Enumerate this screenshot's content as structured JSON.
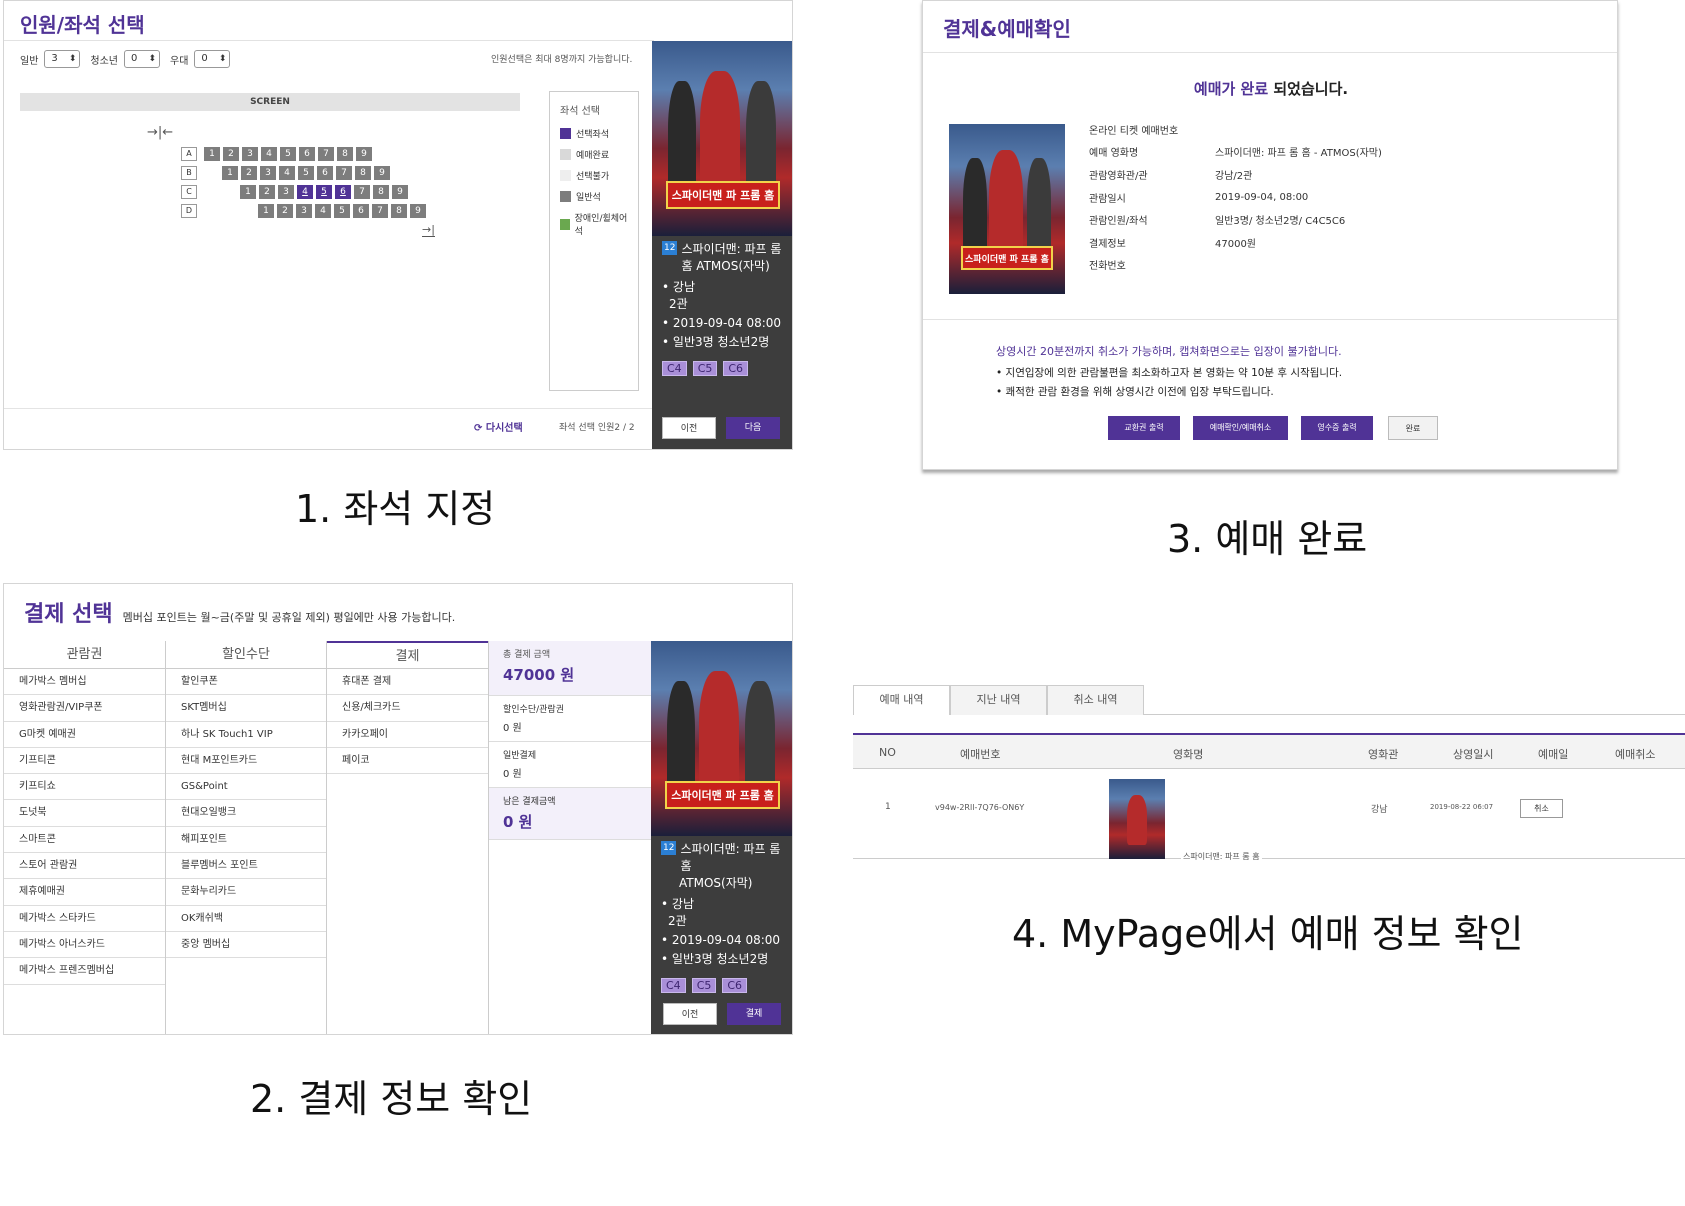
{
  "panel1": {
    "title": "인원/좌석 선택",
    "adult_label": "일반",
    "adult_value": "3",
    "youth_label": "청소년",
    "youth_value": "0",
    "senior_label": "우대",
    "senior_value": "0",
    "notice": "인원선택은 최대 8명까지 가능합니다.",
    "screen": "SCREEN",
    "rows": [
      {
        "label": "A",
        "seats": [
          "1",
          "2",
          "3",
          "4",
          "5",
          "6",
          "7",
          "8",
          "9"
        ]
      },
      {
        "label": "B",
        "seats": [
          "1",
          "2",
          "3",
          "4",
          "5",
          "6",
          "7",
          "8",
          "9"
        ]
      },
      {
        "label": "C",
        "seats": [
          "1",
          "2",
          "3",
          "4",
          "5",
          "6",
          "7",
          "8",
          "9"
        ]
      },
      {
        "label": "D",
        "seats": [
          "1",
          "2",
          "3",
          "4",
          "5",
          "6",
          "7",
          "8",
          "9"
        ]
      }
    ],
    "legend_title": "좌석 선택",
    "legend": [
      {
        "label": "선택좌석",
        "color": "#503396"
      },
      {
        "label": "예매완료",
        "color": "#d9d9d9"
      },
      {
        "label": "선택불가",
        "color": "#eeeeee"
      },
      {
        "label": "일반석",
        "color": "#7d7d7d"
      },
      {
        "label": "장애인/휠체어석",
        "color": "#6aa84f"
      }
    ],
    "reset": "다시선택",
    "seat_count": "좌석 선택 인원2 / 2",
    "prev": "이전",
    "next": "다음"
  },
  "movie": {
    "rating": "12",
    "title": "스파이더맨: 파프 롬 홈 ATMOS(자막)",
    "title_line2": "ATMOS(자막)",
    "poster_text": "스파이더맨 파 프롬 홈",
    "theater": "강남",
    "hall": "2관",
    "datetime": "2019-09-04 08:00",
    "people": "일반3명 청소년2명",
    "seats": [
      "C4",
      "C5",
      "C6"
    ]
  },
  "caption1": "1. 좌석 지정",
  "panel2": {
    "title": "결제 선택",
    "subtitle": "멤버십 포인트는 월~금(주말 및 공휴일 제외) 평일에만 사용 가능합니다.",
    "col1_head": "관람권",
    "col1": [
      "메가박스 멤버십",
      "영화관람권/VIP쿠폰",
      "G마켓 예매권",
      "기프티콘",
      "키프티쇼",
      "도넛북",
      "스마트콘",
      "스토어 관람권",
      "제휴예매권",
      "메가박스 스타카드",
      "메가박스 아너스카드",
      "메가박스 프렌즈멤버십"
    ],
    "col2_head": "할인수단",
    "col2": [
      "할인쿠폰",
      "SKT멤버십",
      "하나 SK Touch1 VIP",
      "현대 M포인트카드",
      "GS&Point",
      "현대오일뱅크",
      "해피포인트",
      "블루멤버스 포인트",
      "문화누리카드",
      "OK캐쉬백",
      "중앙 멤버십"
    ],
    "col3_head": "결제",
    "col3": [
      "휴대폰 결제",
      "신용/체크카드",
      "카카오페이",
      "페이코"
    ],
    "total_label": "총 결제 금액",
    "total_value": "47000 원",
    "discount_label": "할인수단/관람권",
    "discount_value": "0 원",
    "general_label": "일반결제",
    "general_value": "0 원",
    "remain_label": "남은 결제금액",
    "remain_value": "0 원",
    "movie_title": "스파이더맨: 파프 롬 홈",
    "prev": "이전",
    "pay": "결제"
  },
  "caption2": "2. 결제 정보 확인",
  "panel3": {
    "title": "결제&예매확인",
    "done_highlight": "예매가 완료",
    "done_rest": " 되었습니다.",
    "rows": [
      {
        "k": "온라인 티켓 예매번호",
        "v": ""
      },
      {
        "k": "예매 영화명",
        "v": "스파이더맨: 파프 롬 홈 - ATMOS(자막)"
      },
      {
        "k": "관람영화관/관",
        "v": "강남/2관"
      },
      {
        "k": "관람일시",
        "v": "2019-09-04, 08:00"
      },
      {
        "k": "관람인원/좌석",
        "v": "일반3명/ 청소년2명/ C4C5C6"
      },
      {
        "k": "결제정보",
        "v": "47000원"
      },
      {
        "k": "전화번호",
        "v": ""
      }
    ],
    "notice_main": "상영시간 20분전까지 취소가 가능하며, 캡쳐화면으로는 입장이 불가합니다.",
    "notice_1": "• 지연입장에 의한 관람불편을 최소화하고자 본 영화는 약 10분 후 시작됩니다.",
    "notice_2": "• 쾌적한 관람 환경을 위해 상영시간 이전에 입장 부탁드립니다.",
    "btn_exchange": "교환권 출력",
    "btn_cancel": "예매확인/예매취소",
    "btn_receipt": "영수증 출력",
    "btn_done": "완료"
  },
  "caption3": "3. 예매 완료",
  "panel4": {
    "tabs": [
      "예매 내역",
      "지난 내역",
      "취소 내역"
    ],
    "headers": [
      "NO",
      "예매번호",
      "영화명",
      "영화관",
      "상영일시",
      "예매일",
      "예매취소"
    ],
    "row": {
      "no": "1",
      "booking_no": "v94w-2Rll-7Q76-ON6Y",
      "movie": "스파이더맨: 파프 롬 홈",
      "theater": "강남",
      "datetime": "2019-08-22 06:07",
      "cancel": "취소"
    }
  },
  "caption4": "4. MyPage에서 예매 정보 확인",
  "colors": {
    "accent": "#503396",
    "dark_panel": "#3d3d3d"
  }
}
